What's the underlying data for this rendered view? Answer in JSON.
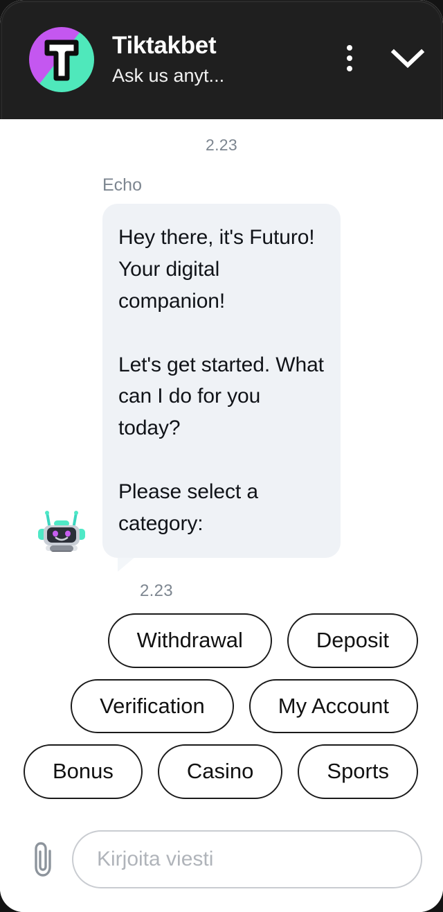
{
  "header": {
    "title": "Tiktakbet",
    "subtitle": "Ask us anyt...",
    "avatar_icon": "tiktakbet-logo-t",
    "menu_icon": "kebab-menu-icon",
    "minimize_icon": "chevron-down-icon",
    "colors": {
      "background": "#1f1f1f",
      "avatar_purple": "#c457f0",
      "avatar_teal": "#4fe8bb"
    }
  },
  "chat": {
    "day_time": "2.23",
    "sender": "Echo",
    "message": "Hey there, it's Futuro! Your digital companion!\n\nLet's get started. What can I do for you today?\n\nPlease select a category:",
    "message_time": "2.23",
    "bot_avatar_icon": "robot-avatar-icon",
    "bubble_color": "#eff2f6"
  },
  "quick_replies": {
    "rows": [
      [
        {
          "label": "Withdrawal"
        },
        {
          "label": "Deposit"
        }
      ],
      [
        {
          "label": "Verification"
        },
        {
          "label": "My Account"
        }
      ],
      [
        {
          "label": "Bonus"
        },
        {
          "label": "Casino"
        },
        {
          "label": "Sports"
        }
      ]
    ]
  },
  "composer": {
    "attach_icon": "paperclip-icon",
    "input_value": "",
    "input_placeholder": "Kirjoita viesti"
  }
}
